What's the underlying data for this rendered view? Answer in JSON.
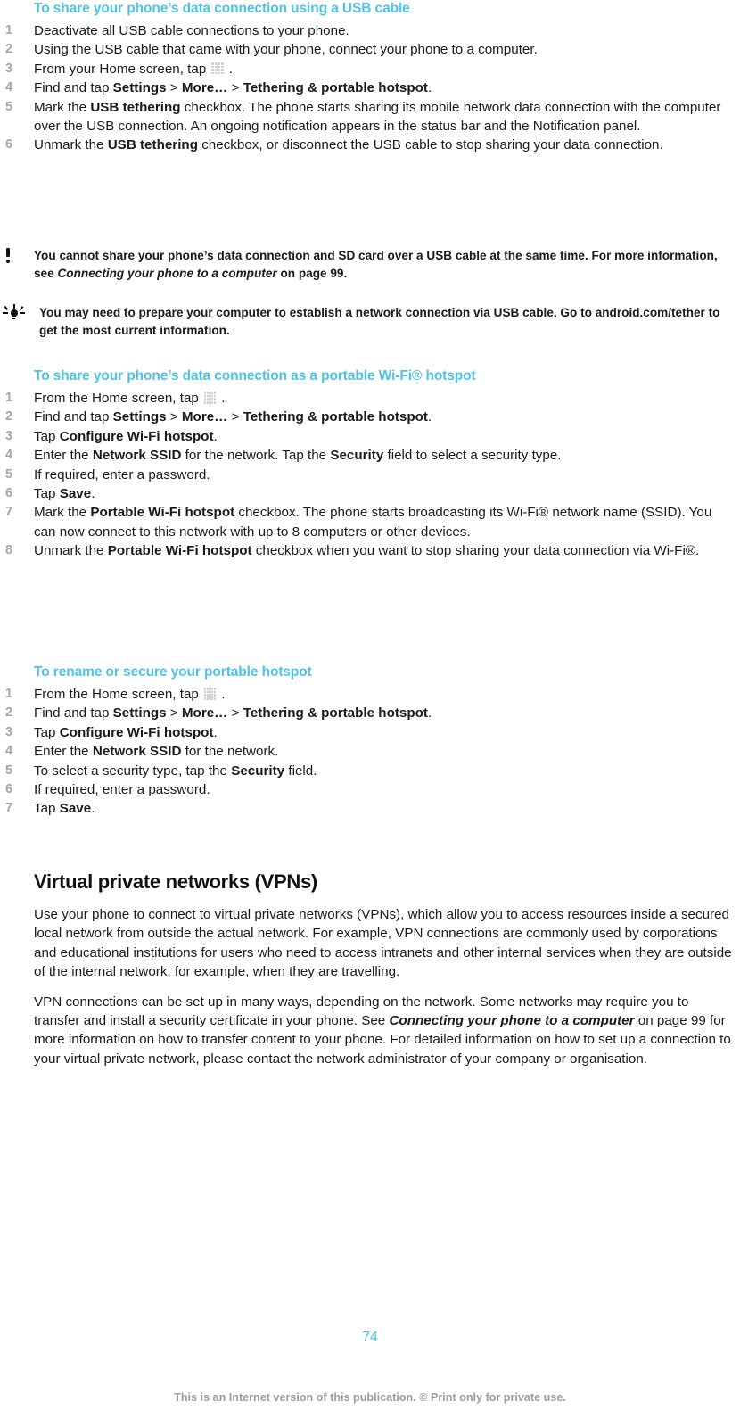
{
  "document": {
    "page_number": "74",
    "footer_note": "This is an Internet version of this publication. © Print only for private use.",
    "heading_color": "#4ec3e8",
    "number_color": "#a6a6a6",
    "footer_color": "#9d9d9d"
  },
  "section_usb": {
    "heading": "To share your phone’s data connection using a USB cable",
    "steps": [
      {
        "num": "1",
        "text_parts": [
          {
            "t": "Deactivate all USB cable connections to your phone."
          }
        ]
      },
      {
        "num": "2",
        "text_parts": [
          {
            "t": "Using the USB cable that came with your phone, connect your phone to a computer."
          }
        ]
      },
      {
        "num": "3",
        "text_parts": [
          {
            "t": "From your Home screen, tap "
          },
          {
            "icon": "app-grid-icon"
          },
          {
            "t": " ."
          }
        ]
      },
      {
        "num": "4",
        "text_parts": [
          {
            "t": "Find and tap "
          },
          {
            "t": "Settings",
            "b": true
          },
          {
            "t": " > "
          },
          {
            "t": "More…",
            "b": true
          },
          {
            "t": " > "
          },
          {
            "t": "Tethering & portable hotspot",
            "b": true
          },
          {
            "t": "."
          }
        ]
      },
      {
        "num": "5",
        "text_parts": [
          {
            "t": "Mark the "
          },
          {
            "t": "USB tethering",
            "b": true
          },
          {
            "t": " checkbox. The phone starts sharing its mobile network data connection with the computer over the USB connection. An ongoing notification appears in the status bar and the Notification panel."
          }
        ]
      },
      {
        "num": "6",
        "text_parts": [
          {
            "t": "Unmark the "
          },
          {
            "t": "USB tethering",
            "b": true
          },
          {
            "t": " checkbox, or disconnect the USB cable to stop sharing your data connection."
          }
        ]
      }
    ]
  },
  "note_warning": {
    "icon": "exclamation-icon",
    "text_parts": [
      {
        "t": "You cannot share your phone’s data connection and SD card over a USB cable at the same time. For more information, see "
      },
      {
        "t": "Connecting your phone to a computer",
        "i": true
      },
      {
        "t": " on page 99."
      }
    ]
  },
  "note_tip": {
    "icon": "lightbulb-icon",
    "text_parts": [
      {
        "t": "You may need to prepare your computer to establish a network connection via USB cable. Go to android.com/tether to get the most current information."
      }
    ]
  },
  "section_hotspot": {
    "heading": "To share your phone’s data connection as a portable Wi-Fi® hotspot",
    "steps": [
      {
        "num": "1",
        "text_parts": [
          {
            "t": "From the Home screen, tap "
          },
          {
            "icon": "app-grid-icon"
          },
          {
            "t": " ."
          }
        ]
      },
      {
        "num": "2",
        "text_parts": [
          {
            "t": "Find and tap "
          },
          {
            "t": "Settings",
            "b": true
          },
          {
            "t": " > "
          },
          {
            "t": "More…",
            "b": true
          },
          {
            "t": " > "
          },
          {
            "t": "Tethering & portable hotspot",
            "b": true
          },
          {
            "t": "."
          }
        ]
      },
      {
        "num": "3",
        "text_parts": [
          {
            "t": "Tap "
          },
          {
            "t": "Configure Wi-Fi hotspot",
            "b": true
          },
          {
            "t": "."
          }
        ]
      },
      {
        "num": "4",
        "text_parts": [
          {
            "t": "Enter the "
          },
          {
            "t": "Network SSID",
            "b": true
          },
          {
            "t": " for the network. Tap the "
          },
          {
            "t": "Security",
            "b": true
          },
          {
            "t": " field to select a security type."
          }
        ]
      },
      {
        "num": "5",
        "text_parts": [
          {
            "t": "If required, enter a password."
          }
        ]
      },
      {
        "num": "6",
        "text_parts": [
          {
            "t": "Tap "
          },
          {
            "t": "Save",
            "b": true
          },
          {
            "t": "."
          }
        ]
      },
      {
        "num": "7",
        "text_parts": [
          {
            "t": "Mark the "
          },
          {
            "t": "Portable Wi-Fi hotspot",
            "b": true
          },
          {
            "t": " checkbox. The phone starts broadcasting its Wi-Fi® network name (SSID). You can now connect to this network with up to 8 computers or other devices."
          }
        ]
      },
      {
        "num": "8",
        "text_parts": [
          {
            "t": "Unmark the "
          },
          {
            "t": "Portable Wi-Fi hotspot",
            "b": true
          },
          {
            "t": " checkbox when you want to stop sharing your data connection via Wi-Fi®."
          }
        ]
      }
    ]
  },
  "section_rename": {
    "heading": "To rename or secure your portable hotspot",
    "steps": [
      {
        "num": "1",
        "text_parts": [
          {
            "t": "From the Home screen, tap "
          },
          {
            "icon": "app-grid-icon"
          },
          {
            "t": " ."
          }
        ]
      },
      {
        "num": "2",
        "text_parts": [
          {
            "t": "Find and tap "
          },
          {
            "t": "Settings",
            "b": true
          },
          {
            "t": " > "
          },
          {
            "t": "More…",
            "b": true
          },
          {
            "t": " > "
          },
          {
            "t": "Tethering & portable hotspot",
            "b": true
          },
          {
            "t": "."
          }
        ]
      },
      {
        "num": "3",
        "text_parts": [
          {
            "t": "Tap "
          },
          {
            "t": "Configure Wi-Fi hotspot",
            "b": true
          },
          {
            "t": "."
          }
        ]
      },
      {
        "num": "4",
        "text_parts": [
          {
            "t": "Enter the "
          },
          {
            "t": "Network SSID",
            "b": true
          },
          {
            "t": " for the network."
          }
        ]
      },
      {
        "num": "5",
        "text_parts": [
          {
            "t": "To select a security type, tap the "
          },
          {
            "t": "Security",
            "b": true
          },
          {
            "t": " field."
          }
        ]
      },
      {
        "num": "6",
        "text_parts": [
          {
            "t": "If required, enter a password."
          }
        ]
      },
      {
        "num": "7",
        "text_parts": [
          {
            "t": "Tap "
          },
          {
            "t": "Save",
            "b": true
          },
          {
            "t": "."
          }
        ]
      }
    ]
  },
  "section_vpn": {
    "heading": "Virtual private networks (VPNs)",
    "paragraphs": [
      {
        "parts": [
          {
            "t": "Use your phone to connect to virtual private networks (VPNs), which allow you to access resources inside a secured local network from outside the actual network. For example, VPN connections are commonly used by corporations and educational institutions for users who need to access intranets and other internal services when they are outside of the internal network, for example, when they are travelling."
          }
        ]
      },
      {
        "parts": [
          {
            "t": "VPN connections can be set up in many ways, depending on the network. Some networks may require you to transfer and install a security certificate in your phone. See "
          },
          {
            "t": "Connecting your phone to a computer",
            "i": true,
            "b": true
          },
          {
            "t": " on page 99 for more information on how to transfer content to your phone. For detailed information on how to set up a connection to your virtual private network, please contact the network administrator of your company or organisation."
          }
        ]
      }
    ]
  }
}
